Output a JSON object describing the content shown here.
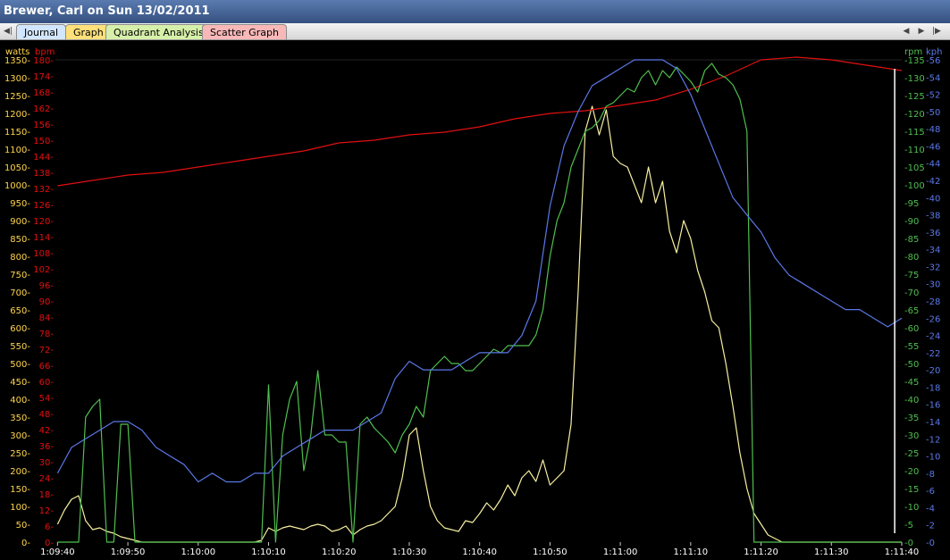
{
  "window": {
    "title": "Brewer, Carl on Sun 13/02/2011"
  },
  "tabs": [
    {
      "label": "Journal",
      "color": "#d2e6ff"
    },
    {
      "label": "Graph",
      "color": "#ffe07a"
    },
    {
      "label": "Quadrant Analysis",
      "color": "#d6efa9"
    },
    {
      "label": "Scatter Graph",
      "color": "#f8b8b8"
    }
  ],
  "nav": {
    "first_icon": "first-icon",
    "prev_icon": "prev-icon",
    "next_icon": "next-icon",
    "last_icon": "last-icon"
  },
  "chart_data": {
    "type": "line",
    "grid": false,
    "background": "#000000",
    "x_ticks": [
      "1:09:40",
      "1:09:50",
      "1:10:00",
      "1:10:10",
      "1:10:20",
      "1:10:30",
      "1:10:40",
      "1:10:50",
      "1:11:00",
      "1:11:10",
      "1:11:20",
      "1:11:30",
      "1:11:40"
    ],
    "x_tick_seconds": [
      0,
      10,
      20,
      30,
      40,
      50,
      60,
      70,
      80,
      90,
      100,
      110,
      120
    ],
    "xlim": [
      -0.3,
      120
    ],
    "marker_line_x": 119,
    "axes": {
      "watts": {
        "label": "watts",
        "side": "left",
        "color": "#ffd54a",
        "ylim": [
          0,
          1350
        ],
        "ticks": [
          "0",
          "50",
          "100",
          "150",
          "200",
          "250",
          "300",
          "350",
          "400",
          "450",
          "500",
          "550",
          "600",
          "650",
          "700",
          "750",
          "800",
          "850",
          "900",
          "950",
          "1000",
          "1050",
          "1100",
          "1150",
          "1200",
          "1250",
          "1300",
          "1350"
        ]
      },
      "bpm": {
        "label": "bpm",
        "side": "left",
        "color": "#e01010",
        "ylim": [
          0,
          180
        ],
        "ticks": [
          "0",
          "6",
          "12",
          "18",
          "24",
          "30",
          "36",
          "42",
          "48",
          "54",
          "60",
          "66",
          "72",
          "78",
          "84",
          "90",
          "96",
          "102",
          "108",
          "114",
          "120",
          "126",
          "132",
          "138",
          "144",
          "150",
          "156",
          "162",
          "168",
          "174",
          "180"
        ]
      },
      "rpm": {
        "label": "rpm",
        "side": "right",
        "color": "#4fbf4f",
        "ylim": [
          0,
          135
        ],
        "ticks": [
          "0",
          "5",
          "10",
          "15",
          "20",
          "25",
          "30",
          "35",
          "40",
          "45",
          "50",
          "55",
          "60",
          "65",
          "70",
          "75",
          "80",
          "85",
          "90",
          "95",
          "100",
          "105",
          "110",
          "115",
          "120",
          "125",
          "130",
          "135"
        ]
      },
      "kph": {
        "label": "kph",
        "side": "right",
        "color": "#5a78e8",
        "ylim": [
          0,
          56
        ],
        "ticks": [
          "0",
          "2",
          "4",
          "6",
          "8",
          "10",
          "12",
          "14",
          "16",
          "18",
          "20",
          "22",
          "24",
          "26",
          "28",
          "30",
          "32",
          "34",
          "36",
          "38",
          "40",
          "42",
          "44",
          "46",
          "48",
          "50",
          "52",
          "54",
          "56"
        ]
      }
    },
    "series": [
      {
        "name": "watts",
        "axis": "watts",
        "color": "#f7efa0",
        "x": [
          0,
          1,
          2,
          3,
          4,
          5,
          6,
          7,
          8,
          9,
          10,
          11,
          12,
          13,
          14,
          15,
          16,
          17,
          18,
          19,
          20,
          21,
          22,
          23,
          24,
          25,
          26,
          27,
          28,
          29,
          30,
          31,
          32,
          33,
          34,
          35,
          36,
          37,
          38,
          39,
          40,
          41,
          42,
          43,
          44,
          45,
          46,
          47,
          48,
          49,
          50,
          51,
          52,
          53,
          54,
          55,
          56,
          57,
          58,
          59,
          60,
          61,
          62,
          63,
          64,
          65,
          66,
          67,
          68,
          69,
          70,
          71,
          72,
          73,
          74,
          75,
          76,
          77,
          78,
          79,
          80,
          81,
          82,
          83,
          84,
          85,
          86,
          87,
          88,
          89,
          90,
          91,
          92,
          93,
          94,
          95,
          96,
          97,
          98,
          99,
          100,
          101,
          102,
          103,
          104,
          105,
          106,
          107,
          108,
          109,
          110,
          111,
          112,
          113,
          114,
          115,
          116,
          117,
          118,
          119,
          120
        ],
        "y": [
          50,
          90,
          120,
          130,
          60,
          35,
          40,
          30,
          25,
          15,
          10,
          5,
          0,
          0,
          0,
          0,
          0,
          0,
          0,
          0,
          0,
          0,
          0,
          0,
          0,
          0,
          0,
          0,
          0,
          5,
          40,
          30,
          40,
          45,
          40,
          35,
          45,
          50,
          45,
          30,
          35,
          45,
          20,
          35,
          45,
          50,
          60,
          80,
          100,
          180,
          300,
          320,
          200,
          100,
          60,
          40,
          35,
          30,
          60,
          55,
          80,
          110,
          90,
          120,
          160,
          130,
          180,
          200,
          170,
          230,
          160,
          180,
          200,
          330,
          700,
          1150,
          1220,
          1140,
          1210,
          1080,
          1060,
          1050,
          1000,
          950,
          1050,
          950,
          1010,
          870,
          810,
          900,
          850,
          760,
          700,
          620,
          600,
          500,
          380,
          250,
          150,
          80,
          50,
          20,
          10,
          0,
          0,
          0,
          0,
          0,
          0,
          0,
          0,
          0,
          0,
          0,
          0,
          0,
          0,
          0,
          0,
          0,
          0
        ]
      },
      {
        "name": "bpm",
        "axis": "bpm",
        "color": "#e01010",
        "x": [
          0,
          5,
          10,
          15,
          20,
          25,
          30,
          35,
          40,
          45,
          50,
          55,
          60,
          65,
          70,
          75,
          80,
          85,
          90,
          95,
          100,
          105,
          110,
          115,
          120
        ],
        "y": [
          133,
          135,
          137,
          138,
          140,
          142,
          144,
          146,
          149,
          150,
          152,
          153,
          155,
          158,
          160,
          161,
          163,
          165,
          169,
          174,
          180,
          181,
          180,
          178,
          176
        ]
      },
      {
        "name": "rpm",
        "axis": "rpm",
        "color": "#4fbf4f",
        "x": [
          0,
          1,
          2,
          3,
          4,
          5,
          6,
          7,
          8,
          9,
          10,
          11,
          12,
          13,
          14,
          15,
          16,
          17,
          18,
          19,
          20,
          21,
          22,
          23,
          24,
          25,
          26,
          27,
          28,
          29,
          30,
          31,
          32,
          33,
          34,
          35,
          36,
          37,
          38,
          39,
          40,
          41,
          42,
          43,
          44,
          45,
          46,
          47,
          48,
          49,
          50,
          51,
          52,
          53,
          54,
          55,
          56,
          57,
          58,
          59,
          60,
          61,
          62,
          63,
          64,
          65,
          66,
          67,
          68,
          69,
          70,
          71,
          72,
          73,
          74,
          75,
          76,
          77,
          78,
          79,
          80,
          81,
          82,
          83,
          84,
          85,
          86,
          87,
          88,
          89,
          90,
          91,
          92,
          93,
          94,
          95,
          96,
          97,
          98,
          99,
          100,
          101,
          102,
          103,
          104,
          105,
          106,
          107,
          108,
          109,
          110,
          111,
          112,
          113,
          114,
          115,
          116,
          117,
          118,
          119,
          120
        ],
        "y": [
          0,
          0,
          0,
          0,
          35,
          38,
          40,
          0,
          0,
          33,
          33,
          0,
          0,
          0,
          0,
          0,
          0,
          0,
          0,
          0,
          0,
          0,
          0,
          0,
          0,
          0,
          0,
          0,
          0,
          0,
          44,
          0,
          30,
          40,
          45,
          20,
          30,
          48,
          30,
          30,
          28,
          28,
          0,
          33,
          35,
          32,
          30,
          28,
          25,
          30,
          33,
          38,
          35,
          48,
          50,
          52,
          50,
          50,
          48,
          48,
          50,
          52,
          54,
          53,
          55,
          55,
          55,
          55,
          58,
          65,
          80,
          90,
          95,
          105,
          110,
          115,
          116,
          118,
          122,
          123,
          125,
          127,
          126,
          130,
          132,
          128,
          132,
          130,
          133,
          131,
          129,
          126,
          132,
          134,
          131,
          130,
          128,
          124,
          115,
          0,
          0,
          0,
          0,
          0,
          0,
          0,
          0,
          0,
          0,
          0,
          0,
          0,
          0,
          0,
          0,
          0,
          0,
          0,
          0,
          0,
          0
        ]
      },
      {
        "name": "kph",
        "axis": "kph",
        "color": "#5a78e8",
        "x": [
          0,
          2,
          4,
          6,
          8,
          10,
          12,
          14,
          16,
          18,
          20,
          22,
          24,
          26,
          28,
          30,
          32,
          34,
          36,
          38,
          40,
          42,
          44,
          46,
          48,
          50,
          52,
          54,
          56,
          58,
          60,
          62,
          64,
          66,
          68,
          70,
          72,
          74,
          76,
          78,
          80,
          82,
          84,
          86,
          88,
          90,
          92,
          94,
          96,
          98,
          100,
          102,
          104,
          106,
          108,
          110,
          112,
          114,
          116,
          118,
          120
        ],
        "y": [
          8,
          11,
          12,
          13,
          14,
          14,
          13,
          11,
          10,
          9,
          7,
          8,
          7,
          7,
          8,
          8,
          10,
          11,
          12,
          13,
          13,
          13,
          14,
          15,
          19,
          21,
          20,
          20,
          20,
          21,
          22,
          22,
          22,
          24,
          28,
          39,
          46,
          50,
          53,
          54,
          55,
          56,
          56,
          56,
          55,
          52,
          48,
          44,
          40,
          38,
          36,
          33,
          31,
          30,
          29,
          28,
          27,
          27,
          26,
          25,
          26
        ]
      }
    ]
  }
}
